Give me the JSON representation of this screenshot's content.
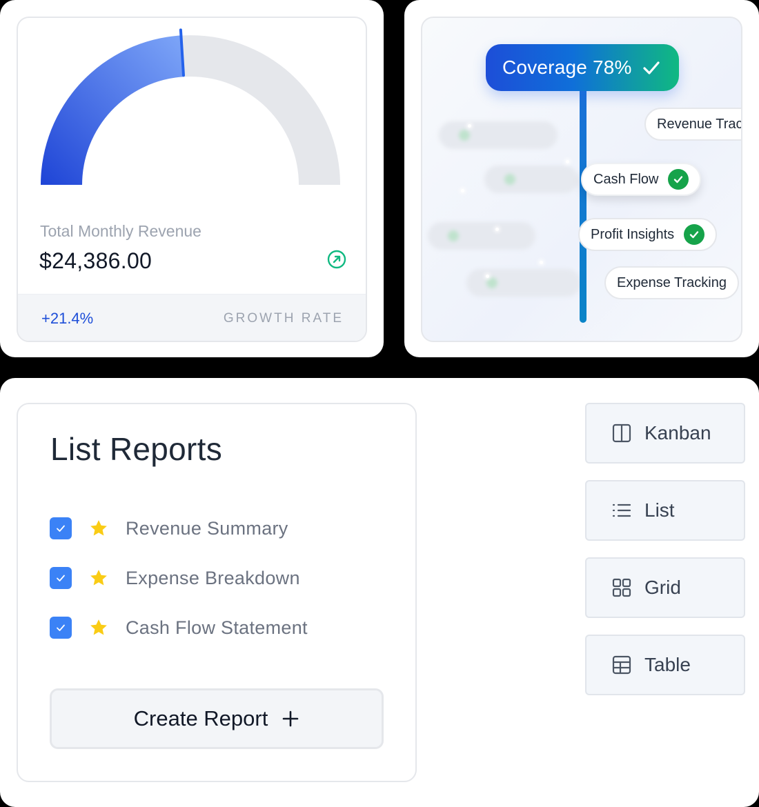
{
  "revenue": {
    "label": "Total Monthly Revenue",
    "value": "$24,386.00",
    "growth_value": "+21.4%",
    "growth_label": "GROWTH RATE",
    "gauge_progress": 0.48,
    "trend_icon": "arrow-up-right-circle-icon",
    "colors": {
      "accent": "#2f5ae0",
      "accent_light": "#7aa2f7",
      "track": "#e5e7eb",
      "trend": "#10b981",
      "growth": "#1d4ed8"
    }
  },
  "coverage": {
    "badge_label": "Coverage 78%",
    "badge_icon": "check-icon",
    "chips": [
      {
        "label": "Revenue Tracking",
        "checked": false
      },
      {
        "label": "Cash Flow",
        "checked": true
      },
      {
        "label": "Profit Insights",
        "checked": true
      },
      {
        "label": "Expense Tracking",
        "checked": false
      }
    ],
    "colors": {
      "gradient_start": "#1d4ed8",
      "gradient_end": "#10b981",
      "check": "#16a34a"
    }
  },
  "reports": {
    "title": "List Reports",
    "items": [
      {
        "label": "Revenue Summary",
        "checked": true,
        "starred": true
      },
      {
        "label": "Expense Breakdown",
        "checked": true,
        "starred": true
      },
      {
        "label": "Cash Flow Statement",
        "checked": true,
        "starred": true
      }
    ],
    "create_button": "Create Report",
    "create_icon": "plus-icon",
    "colors": {
      "checkbox": "#3b82f6",
      "star": "#facc15"
    }
  },
  "views": [
    {
      "label": "Kanban",
      "icon": "kanban-icon"
    },
    {
      "label": "List",
      "icon": "list-icon"
    },
    {
      "label": "Grid",
      "icon": "grid-icon"
    },
    {
      "label": "Table",
      "icon": "table-icon"
    }
  ]
}
